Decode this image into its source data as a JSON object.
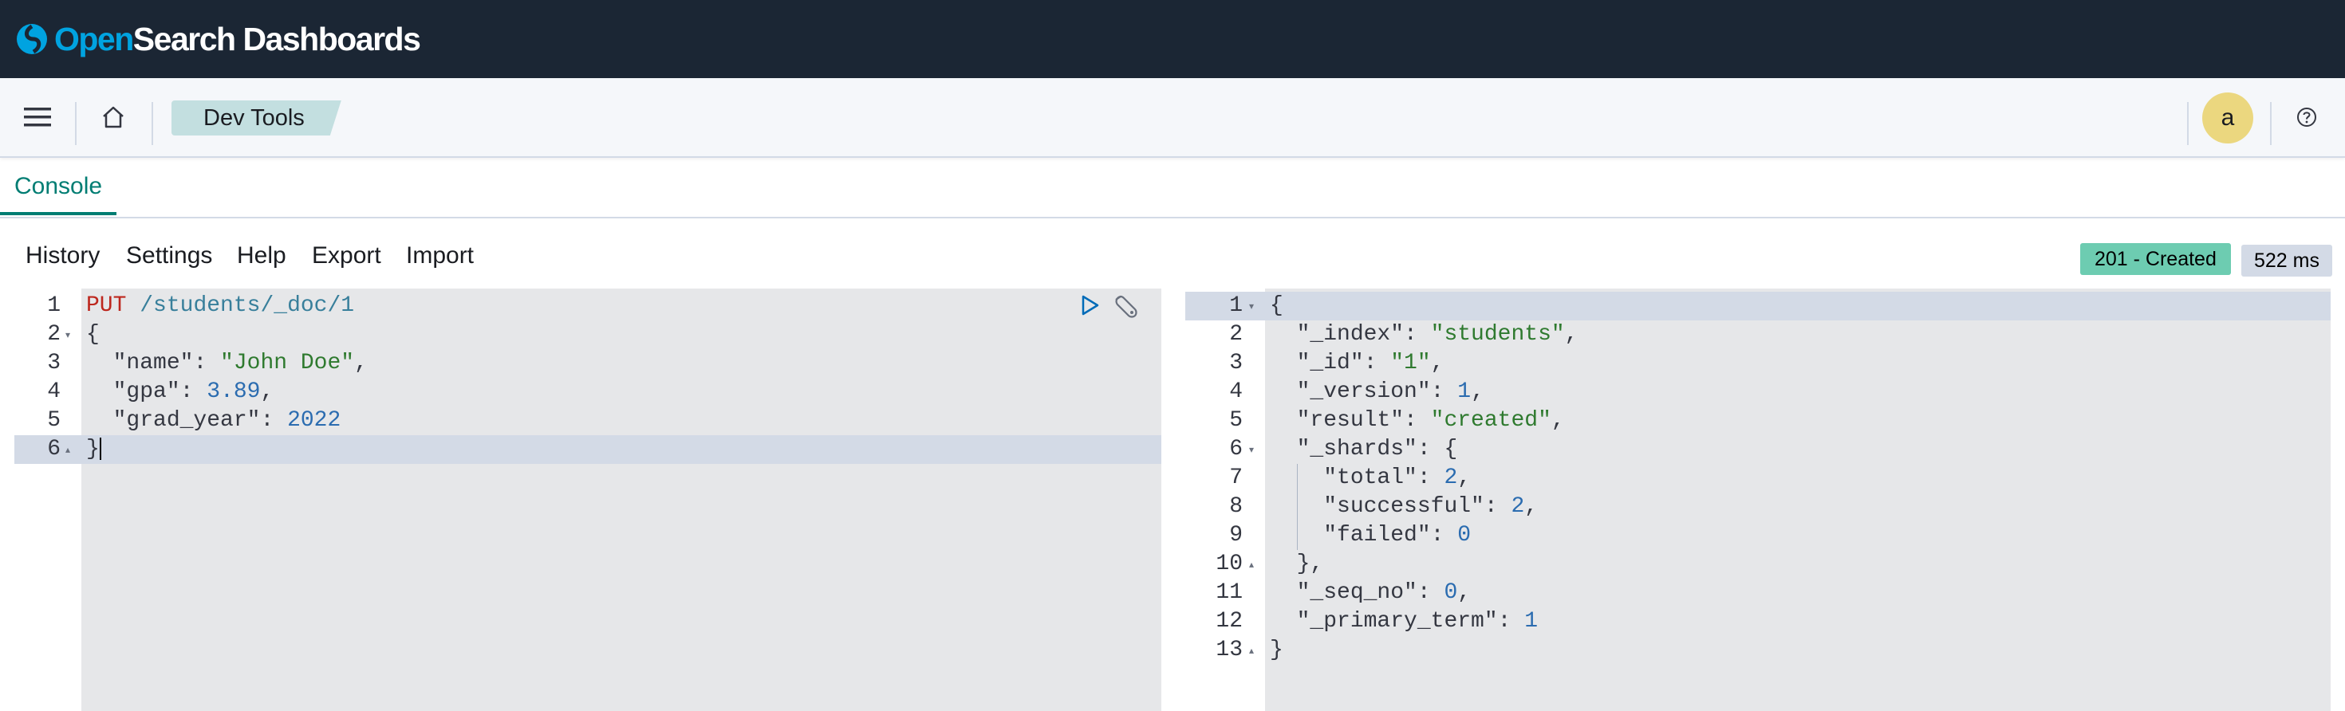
{
  "header": {
    "brand_open": "Open",
    "brand_rest": "Search Dashboards"
  },
  "nav": {
    "breadcrumb": "Dev Tools",
    "avatar_initial": "a"
  },
  "tabs": [
    {
      "label": "Console",
      "active": true
    }
  ],
  "toolbar": {
    "items": [
      "History",
      "Settings",
      "Help",
      "Export",
      "Import"
    ],
    "status": "201 - Created",
    "time": "522 ms"
  },
  "request_editor": {
    "lines": [
      [
        {
          "t": "method",
          "v": "PUT"
        },
        {
          "t": "punct",
          "v": " "
        },
        {
          "t": "url",
          "v": "/students/_doc/1"
        }
      ],
      [
        {
          "t": "punct",
          "v": "{"
        }
      ],
      [
        {
          "t": "punct",
          "v": "  "
        },
        {
          "t": "key",
          "v": "\"name\""
        },
        {
          "t": "punct",
          "v": ": "
        },
        {
          "t": "str",
          "v": "\"John Doe\""
        },
        {
          "t": "punct",
          "v": ","
        }
      ],
      [
        {
          "t": "punct",
          "v": "  "
        },
        {
          "t": "key",
          "v": "\"gpa\""
        },
        {
          "t": "punct",
          "v": ": "
        },
        {
          "t": "num",
          "v": "3.89"
        },
        {
          "t": "punct",
          "v": ","
        }
      ],
      [
        {
          "t": "punct",
          "v": "  "
        },
        {
          "t": "key",
          "v": "\"grad_year\""
        },
        {
          "t": "punct",
          "v": ": "
        },
        {
          "t": "num",
          "v": "2022"
        }
      ],
      [
        {
          "t": "punct",
          "v": "}"
        }
      ]
    ],
    "fold_open": [
      2
    ],
    "fold_close": [
      6
    ],
    "active_line": 6
  },
  "response_editor": {
    "lines": [
      [
        {
          "t": "punct",
          "v": "{"
        }
      ],
      [
        {
          "t": "punct",
          "v": "  "
        },
        {
          "t": "key",
          "v": "\"_index\""
        },
        {
          "t": "punct",
          "v": ": "
        },
        {
          "t": "str",
          "v": "\"students\""
        },
        {
          "t": "punct",
          "v": ","
        }
      ],
      [
        {
          "t": "punct",
          "v": "  "
        },
        {
          "t": "key",
          "v": "\"_id\""
        },
        {
          "t": "punct",
          "v": ": "
        },
        {
          "t": "str",
          "v": "\"1\""
        },
        {
          "t": "punct",
          "v": ","
        }
      ],
      [
        {
          "t": "punct",
          "v": "  "
        },
        {
          "t": "key",
          "v": "\"_version\""
        },
        {
          "t": "punct",
          "v": ": "
        },
        {
          "t": "num",
          "v": "1"
        },
        {
          "t": "punct",
          "v": ","
        }
      ],
      [
        {
          "t": "punct",
          "v": "  "
        },
        {
          "t": "key",
          "v": "\"result\""
        },
        {
          "t": "punct",
          "v": ": "
        },
        {
          "t": "str",
          "v": "\"created\""
        },
        {
          "t": "punct",
          "v": ","
        }
      ],
      [
        {
          "t": "punct",
          "v": "  "
        },
        {
          "t": "key",
          "v": "\"_shards\""
        },
        {
          "t": "punct",
          "v": ": {"
        }
      ],
      [
        {
          "t": "punct",
          "v": "    "
        },
        {
          "t": "key",
          "v": "\"total\""
        },
        {
          "t": "punct",
          "v": ": "
        },
        {
          "t": "num",
          "v": "2"
        },
        {
          "t": "punct",
          "v": ","
        }
      ],
      [
        {
          "t": "punct",
          "v": "    "
        },
        {
          "t": "key",
          "v": "\"successful\""
        },
        {
          "t": "punct",
          "v": ": "
        },
        {
          "t": "num",
          "v": "2"
        },
        {
          "t": "punct",
          "v": ","
        }
      ],
      [
        {
          "t": "punct",
          "v": "    "
        },
        {
          "t": "key",
          "v": "\"failed\""
        },
        {
          "t": "punct",
          "v": ": "
        },
        {
          "t": "num",
          "v": "0"
        }
      ],
      [
        {
          "t": "punct",
          "v": "  },"
        }
      ],
      [
        {
          "t": "punct",
          "v": "  "
        },
        {
          "t": "key",
          "v": "\"_seq_no\""
        },
        {
          "t": "punct",
          "v": ": "
        },
        {
          "t": "num",
          "v": "0"
        },
        {
          "t": "punct",
          "v": ","
        }
      ],
      [
        {
          "t": "punct",
          "v": "  "
        },
        {
          "t": "key",
          "v": "\"_primary_term\""
        },
        {
          "t": "punct",
          "v": ": "
        },
        {
          "t": "num",
          "v": "1"
        }
      ],
      [
        {
          "t": "punct",
          "v": "}"
        }
      ]
    ],
    "fold_open": [
      1,
      6
    ],
    "fold_close": [
      10,
      13
    ],
    "active_line": 1
  },
  "colors": {
    "header_bg": "#1b2634",
    "accent": "#017d73",
    "status_ok": "#6dccb1",
    "string": "#2f7a2f",
    "number": "#2b6cb0",
    "method": "#bd271e"
  },
  "icons": [
    "opensearch-logo-icon",
    "menu-icon",
    "home-icon",
    "help-icon",
    "play-icon",
    "wrench-icon"
  ]
}
